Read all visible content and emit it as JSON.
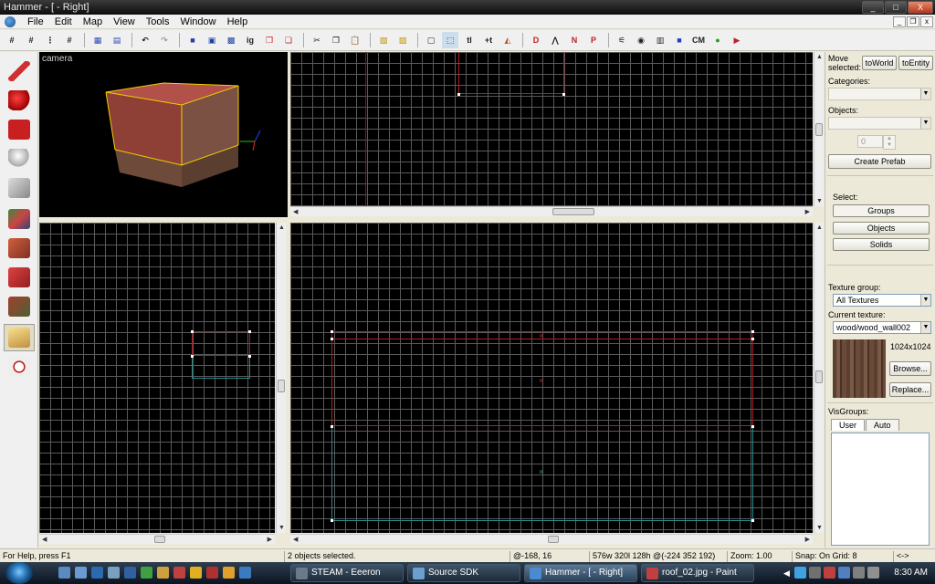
{
  "window": {
    "title": "Hammer - [ - Right]",
    "controls": {
      "minimize": "_",
      "maximize": "□",
      "close": "X"
    },
    "mdi_controls": [
      "_",
      "❐",
      "x"
    ]
  },
  "menu": [
    "File",
    "Edit",
    "Map",
    "View",
    "Tools",
    "Window",
    "Help"
  ],
  "toolbar": {
    "buttons": [
      "grid-icon",
      "3d-grid-icon",
      "dot-grid-icon",
      "hash-grid-icon",
      "group-icon",
      "ungroup-icon",
      "undo-icon",
      "redo-icon",
      "carve-icon",
      "hide-icon",
      "show-icon",
      "quickhide-icon",
      "cordon-icon",
      "cordon-off-icon",
      "cut-icon",
      "copy-icon",
      "paste-icon",
      "hazard-icon",
      "hazard-alt-icon",
      "select-icon",
      "select-dotted-icon",
      "texture-lock-icon",
      "texture-scale-icon",
      "flip-icon",
      "model-icon",
      "path-icon",
      "vertex-icon",
      "decal-icon",
      "displacement-icon",
      "globe-icon",
      "entity-icon",
      "cube-blue-icon",
      "green-ball-icon",
      "run-icon"
    ],
    "text_buttons": {
      "tl": "tl",
      "cm": "CM"
    }
  },
  "viewports": {
    "camera_label": "camera"
  },
  "right_panel": {
    "move_selected_label": "Move selected:",
    "to_world": "toWorld",
    "to_entity": "toEntity",
    "categories_label": "Categories:",
    "objects_label": "Objects:",
    "stepper_value": "0",
    "create_prefab": "Create Prefab",
    "select_label": "Select:",
    "groups": "Groups",
    "objects": "Objects",
    "solids": "Solids",
    "texture_group_label": "Texture group:",
    "texture_group_value": "All Textures",
    "current_texture_label": "Current texture:",
    "current_texture_value": "wood/wood_wall002",
    "texture_size": "1024x1024",
    "browse": "Browse...",
    "replace": "Replace...",
    "visgroups_label": "VisGroups:",
    "tab_user": "User",
    "tab_auto": "Auto"
  },
  "status": {
    "help": "For Help, press F1",
    "selection": "2 objects selected.",
    "coords": "@-168, 16",
    "dimensions": "576w 320l 128h @(-224 352 192)",
    "zoom": "Zoom: 1.00",
    "snap": "Snap: On Grid: 8",
    "extra": "<->"
  },
  "taskbar": {
    "tasks": [
      {
        "label": "STEAM - Eeeron",
        "icon_color": "#6a7a8a"
      },
      {
        "label": "Source SDK",
        "icon_color": "#6aa0d0"
      },
      {
        "label": "Hammer - [ - Right]",
        "icon_color": "#4a8ad0"
      },
      {
        "label": "roof_02.jpg - Paint",
        "icon_color": "#c04040"
      }
    ],
    "clock": "8:30 AM"
  }
}
